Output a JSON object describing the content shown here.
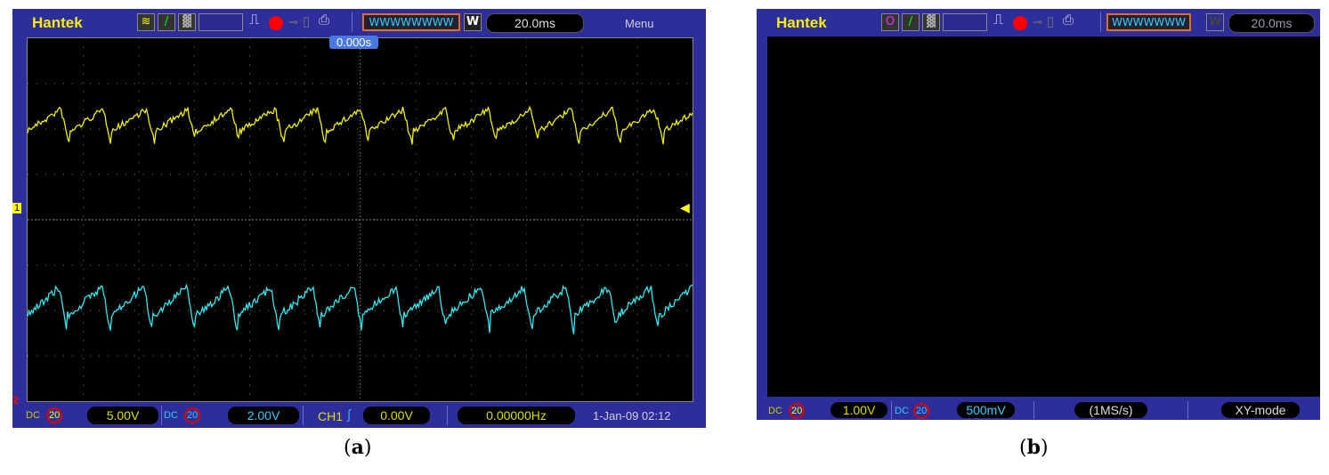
{
  "panel_a": {
    "brand": "Hantek",
    "timebase": "20.0ms",
    "w_label": "W",
    "menu": "Menu",
    "trigger_time": "0.000s",
    "ch1_marker": "1",
    "ch2_marker": "2",
    "ch1_coupling": "DC",
    "ch1_bw": "20",
    "ch1_scale": "5.00V",
    "ch2_coupling": "DC",
    "ch2_bw": "20",
    "ch2_scale": "2.00V",
    "trigger_source": "CH1",
    "trigger_level": "0.00V",
    "frequency": "0.00000Hz",
    "datetime": "1-Jan-09 02:12",
    "caption": "a"
  },
  "panel_b": {
    "brand": "Hantek",
    "timebase": "20.0ms",
    "w_label": "W",
    "ch1_coupling": "DC",
    "ch1_bw": "20",
    "ch1_scale": "1.00V",
    "ch2_coupling": "DC",
    "ch2_bw": "20",
    "ch2_scale": "500mV",
    "sample_rate": "(1MS/s)",
    "mode": "XY-mode",
    "caption": "b"
  },
  "colors": {
    "ch1": "#f0f000",
    "ch2": "#30e8f0",
    "xy": "#e030e0",
    "frame": "#2e2e9a"
  }
}
